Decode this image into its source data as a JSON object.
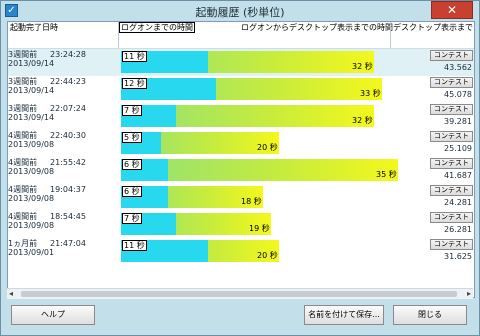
{
  "window": {
    "title": "起動履歴 (秒単位)",
    "close_label": "✕"
  },
  "header": {
    "date_col": "起動完了日時",
    "logon_col": "ログオンまでの時間",
    "desktop_col": "ログオンからデスクトップ表示までの時間",
    "total_col": "デスクトップ表示までの合計時間"
  },
  "rows": [
    {
      "relative": "3週間前",
      "time": "23:24:28",
      "date": "2013/09/14",
      "logon_label": "11 秒",
      "logon_seconds": 11,
      "total_label": "32 秒",
      "total_seconds": 32,
      "contest_label": "コンテスト",
      "score": "43.562",
      "selected": true
    },
    {
      "relative": "3週間前",
      "time": "22:44:23",
      "date": "2013/09/14",
      "logon_label": "12 秒",
      "logon_seconds": 12,
      "total_label": "33 秒",
      "total_seconds": 33,
      "contest_label": "コンテスト",
      "score": "45.078",
      "selected": false
    },
    {
      "relative": "3週間前",
      "time": "22:07:24",
      "date": "2013/09/14",
      "logon_label": "7 秒",
      "logon_seconds": 7,
      "total_label": "32 秒",
      "total_seconds": 32,
      "contest_label": "コンテスト",
      "score": "39.281",
      "selected": false
    },
    {
      "relative": "4週間前",
      "time": "22:40:30",
      "date": "2013/09/08",
      "logon_label": "5 秒",
      "logon_seconds": 5,
      "total_label": "20 秒",
      "total_seconds": 20,
      "contest_label": "コンテスト",
      "score": "25.109",
      "selected": false
    },
    {
      "relative": "4週間前",
      "time": "21:55:42",
      "date": "2013/09/08",
      "logon_label": "6 秒",
      "logon_seconds": 6,
      "total_label": "35 秒",
      "total_seconds": 35,
      "contest_label": "コンテスト",
      "score": "41.687",
      "selected": false
    },
    {
      "relative": "4週間前",
      "time": "19:04:37",
      "date": "2013/09/08",
      "logon_label": "6 秒",
      "logon_seconds": 6,
      "total_label": "18 秒",
      "total_seconds": 18,
      "contest_label": "コンテスト",
      "score": "24.281",
      "selected": false
    },
    {
      "relative": "4週間前",
      "time": "18:54:45",
      "date": "2013/09/08",
      "logon_label": "7 秒",
      "logon_seconds": 7,
      "total_label": "19 秒",
      "total_seconds": 19,
      "contest_label": "コンテスト",
      "score": "26.281",
      "selected": false
    },
    {
      "relative": "1ヵ月前",
      "time": "21:47:04",
      "date": "2013/09/01",
      "logon_label": "11 秒",
      "logon_seconds": 11,
      "total_label": "20 秒",
      "total_seconds": 20,
      "contest_label": "コンテスト",
      "score": "31.625",
      "selected": false
    }
  ],
  "scrollbar": {
    "left_arrow": "◂",
    "right_arrow": "▸"
  },
  "footer": {
    "help_label": "ヘルプ",
    "save_label": "名前を付けて保存...",
    "close_label": "閉じる"
  },
  "colors": {
    "logon_segment": "#27d8ee",
    "desktop_gradient_start": "#8fe07a",
    "desktop_gradient_end": "#f4f81c",
    "selected_row": "#dff1f5"
  }
}
